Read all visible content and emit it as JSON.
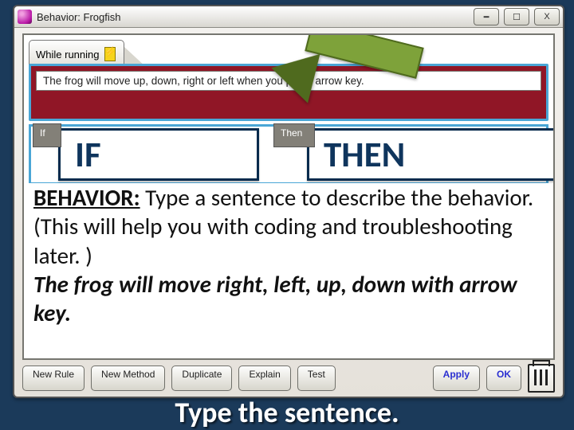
{
  "window": {
    "title": "Behavior: Frogfish",
    "min_glyph": "━",
    "max_glyph": "☐",
    "close_glyph": "X"
  },
  "trigger_tab": {
    "label": "While running"
  },
  "description_field": "The frog will move up, down, right or left when you press arrow key.",
  "rule": {
    "if_caption": "If",
    "then_caption": "Then",
    "if_big": "IF",
    "then_big": "THEN"
  },
  "instruction": {
    "lead": "BEHAVIOR:",
    "body": " Type a sentence to describe the behavior.   (This will help you with coding and troubleshooting later. )",
    "example": "The frog will move right, left, up, down with arrow key."
  },
  "buttons": {
    "new_rule": "New Rule",
    "new_method": "New Method",
    "duplicate": "Duplicate",
    "explain": "Explain",
    "test": "Test",
    "apply": "Apply",
    "ok": "OK"
  },
  "banner": "Type the sentence."
}
